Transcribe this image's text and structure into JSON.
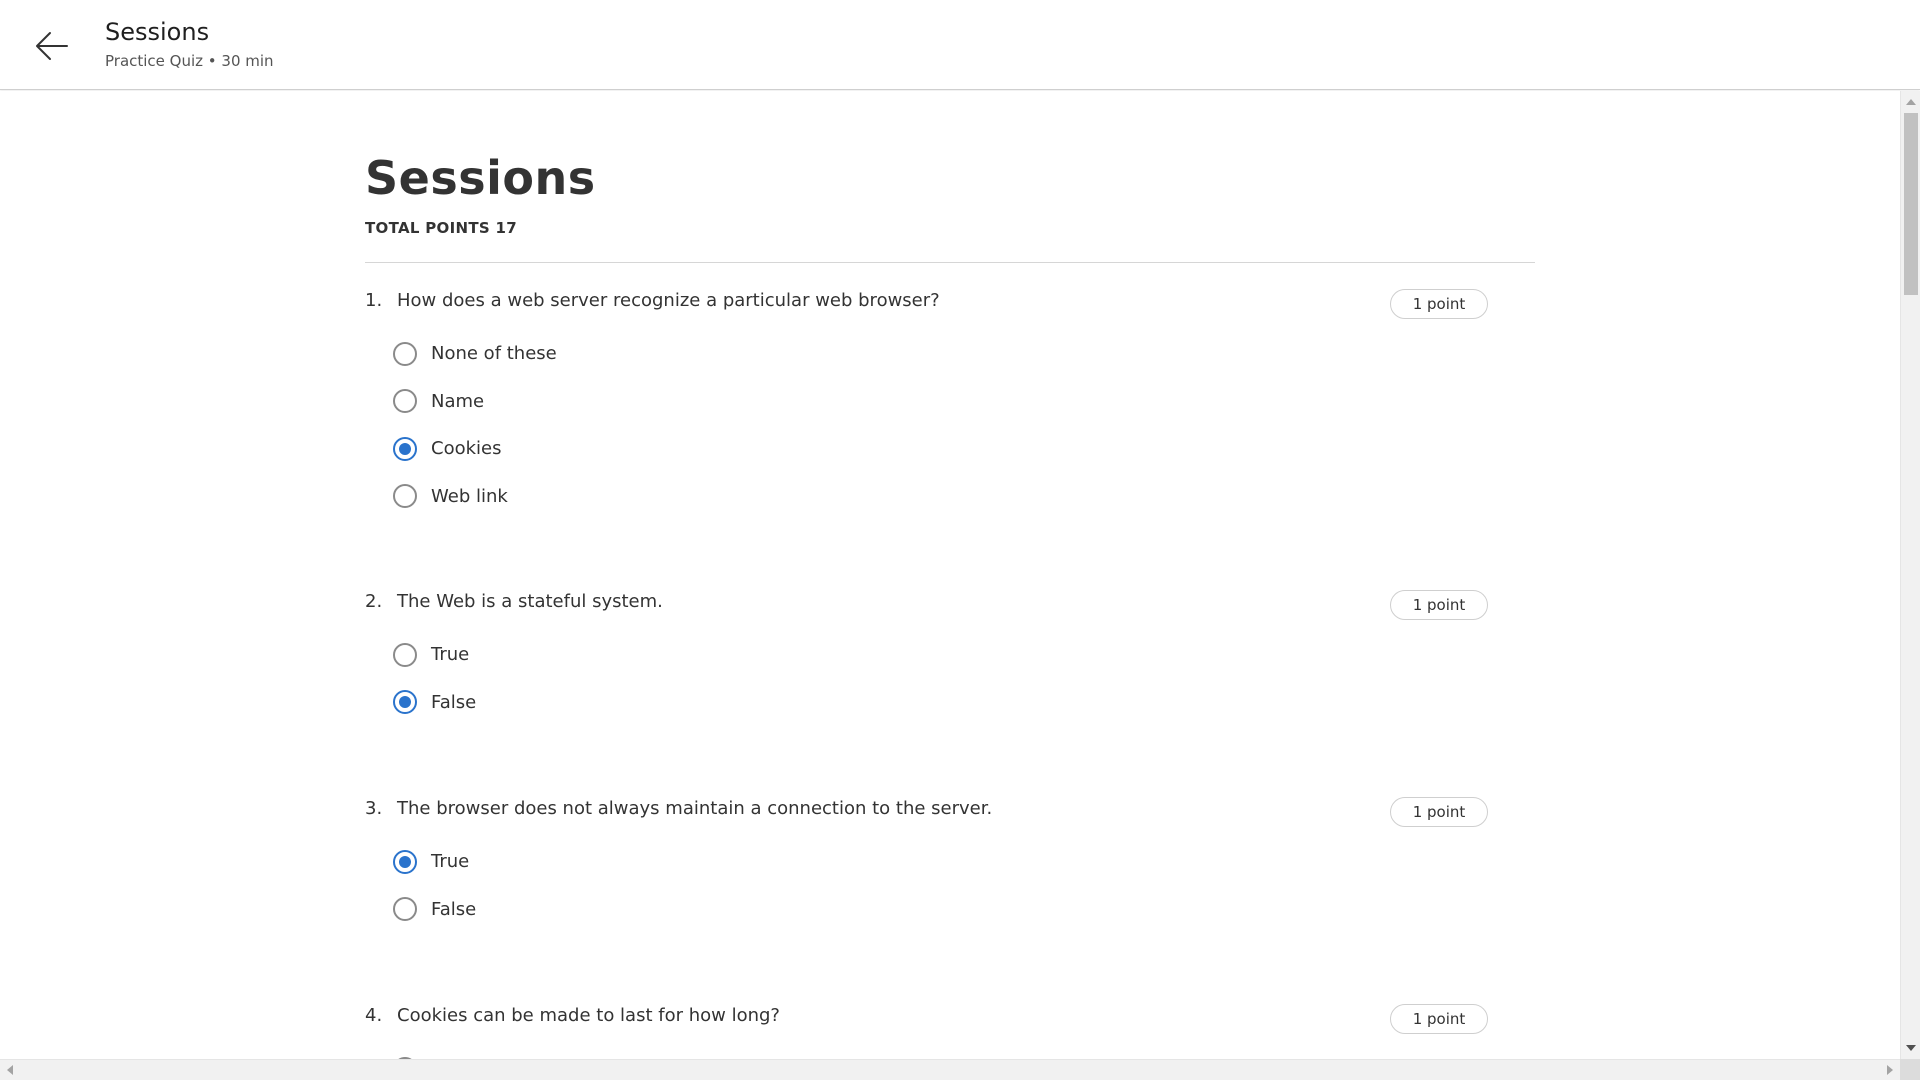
{
  "header": {
    "title": "Sessions",
    "subtitle": "Practice Quiz • 30 min",
    "back_icon": "arrow-left-icon"
  },
  "quiz": {
    "title": "Sessions",
    "total_points": "TOTAL POINTS 17"
  },
  "colors": {
    "accent": "#2a73cc",
    "text": "#333333",
    "divider": "#d6d6d6"
  },
  "questions": [
    {
      "number": "1.",
      "text": "How does a web server recognize a particular web browser?",
      "points": "1 point",
      "options": [
        {
          "label": "None of these",
          "selected": false
        },
        {
          "label": "Name",
          "selected": false
        },
        {
          "label": "Cookies",
          "selected": true
        },
        {
          "label": "Web link",
          "selected": false
        }
      ]
    },
    {
      "number": "2.",
      "text": "The Web is a stateful system.",
      "points": "1 point",
      "options": [
        {
          "label": "True",
          "selected": false
        },
        {
          "label": "False",
          "selected": true
        }
      ]
    },
    {
      "number": "3.",
      "text": "The browser does not always maintain a connection to the server.",
      "points": "1 point",
      "options": [
        {
          "label": "True",
          "selected": true
        },
        {
          "label": "False",
          "selected": false
        }
      ]
    },
    {
      "number": "4.",
      "text": "Cookies can be made to last for how long?",
      "points": "1 point",
      "options": []
    }
  ]
}
